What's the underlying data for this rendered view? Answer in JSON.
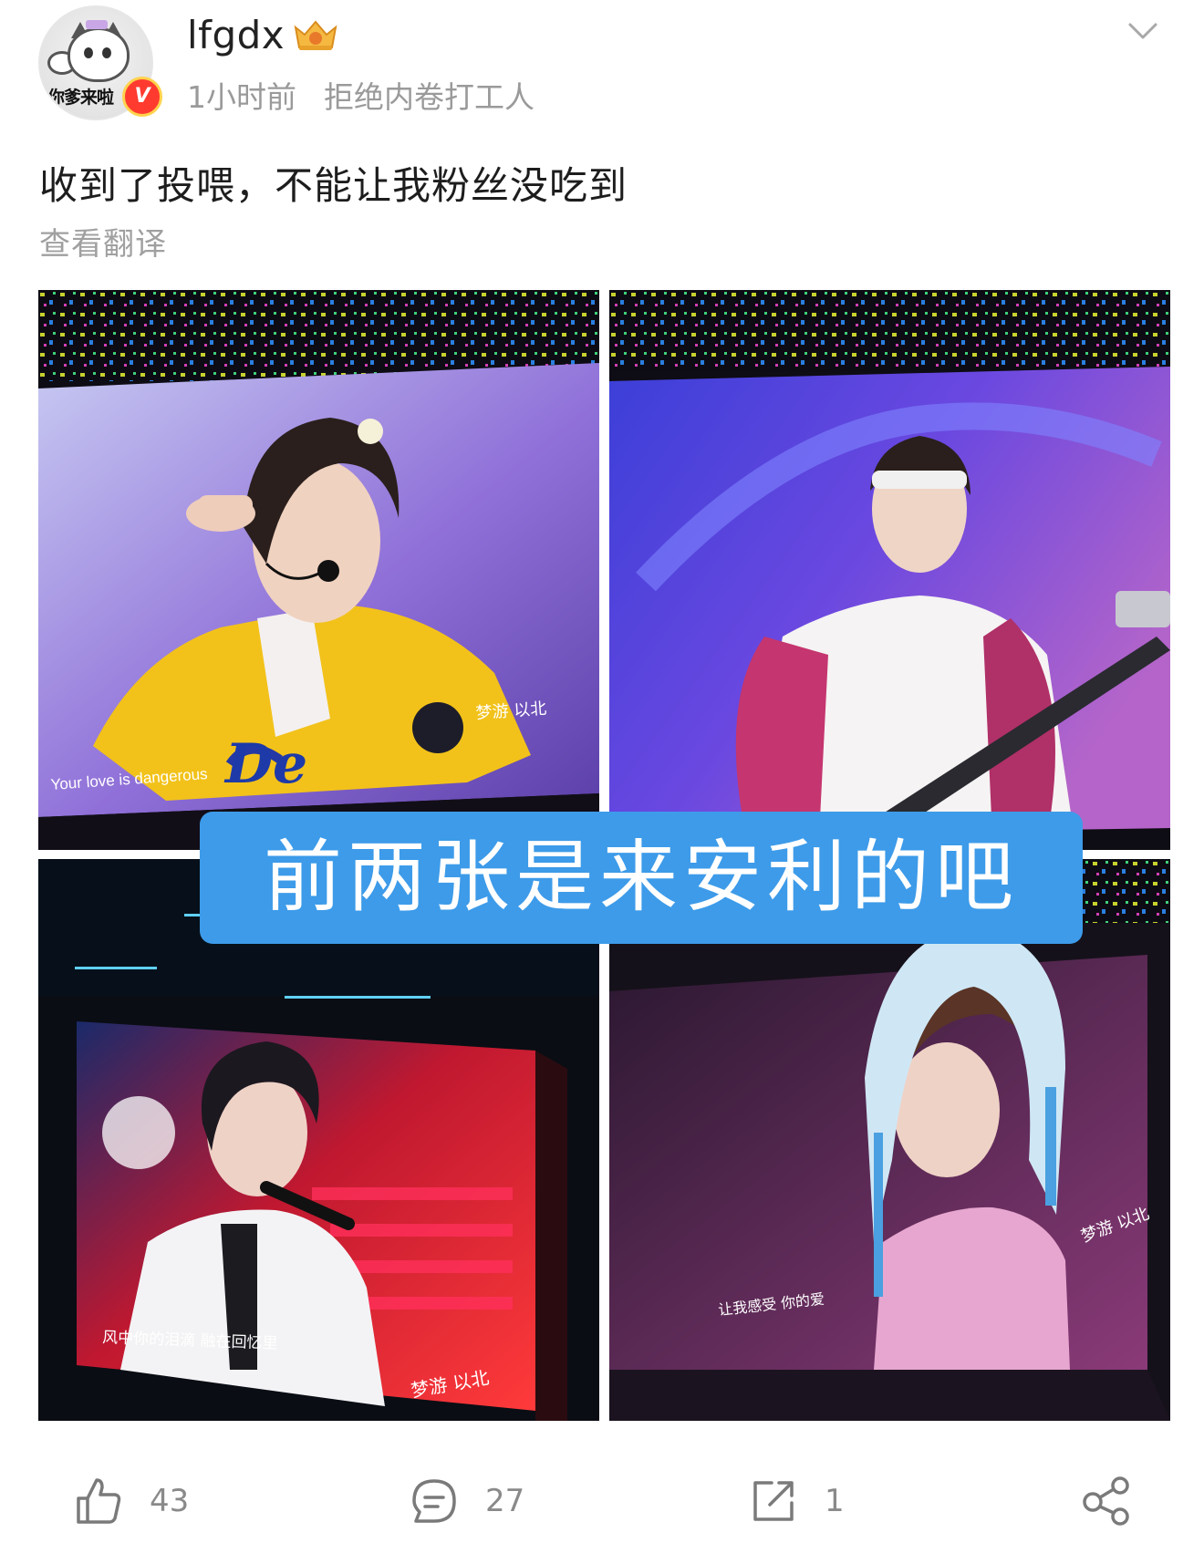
{
  "post": {
    "author": {
      "name": "lfgdx",
      "avatar_caption": "你爹来啦",
      "verified_mark": "V",
      "badge_icon": "crown-badge-icon"
    },
    "time": "1小时前",
    "source": "拒绝内卷打工人",
    "text": "收到了投喂，不能让我粉丝没吃到",
    "translate_link": "查看翻译",
    "overlay_caption": "前两张是来安利的吧",
    "images": [
      {
        "subtitle": "Your love is dangerous",
        "watermark": "梦游 以北"
      },
      {
        "subtitle": "",
        "watermark": ""
      },
      {
        "subtitle": "风中你的泪滴 融在回忆里",
        "watermark": "梦游 以北"
      },
      {
        "subtitle": "让我感受 你的爱",
        "watermark": "梦游 以北"
      }
    ]
  },
  "actions": {
    "like": {
      "icon": "thumbs-up-icon",
      "count": "43"
    },
    "comment": {
      "icon": "comment-icon",
      "count": "27"
    },
    "repost": {
      "icon": "repost-icon",
      "count": "1"
    },
    "share": {
      "icon": "share-icon"
    }
  },
  "colors": {
    "overlay_blue": "#3d9be9",
    "meta_gray": "#9a9a9a",
    "verified_red": "#ff3b30"
  }
}
